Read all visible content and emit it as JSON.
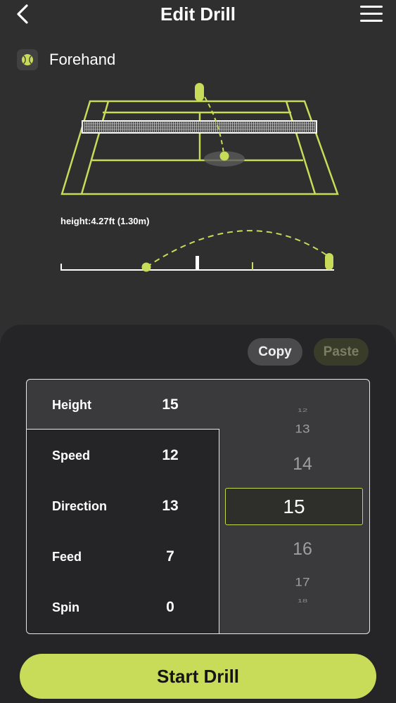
{
  "header": {
    "title": "Edit Drill",
    "back_icon": "chevron-left-icon",
    "menu_icon": "hamburger-menu-icon"
  },
  "stroke": {
    "label": "Forehand",
    "icon": "tennis-ball-icon"
  },
  "trajectory": {
    "height_label": "height:4.27ft (1.30m)"
  },
  "actions": {
    "copy_label": "Copy",
    "paste_label": "Paste"
  },
  "params": [
    {
      "name": "Height",
      "value": "15"
    },
    {
      "name": "Speed",
      "value": "12"
    },
    {
      "name": "Direction",
      "value": "13"
    },
    {
      "name": "Feed",
      "value": "7"
    },
    {
      "name": "Spin",
      "value": "0"
    }
  ],
  "picker": {
    "options": [
      "12",
      "13",
      "14",
      "15",
      "16",
      "17",
      "18"
    ],
    "selected": "15"
  },
  "start_label": "Start Drill",
  "colors": {
    "accent": "#c9dc59",
    "background": "#2f2f30",
    "panel": "#252527"
  }
}
